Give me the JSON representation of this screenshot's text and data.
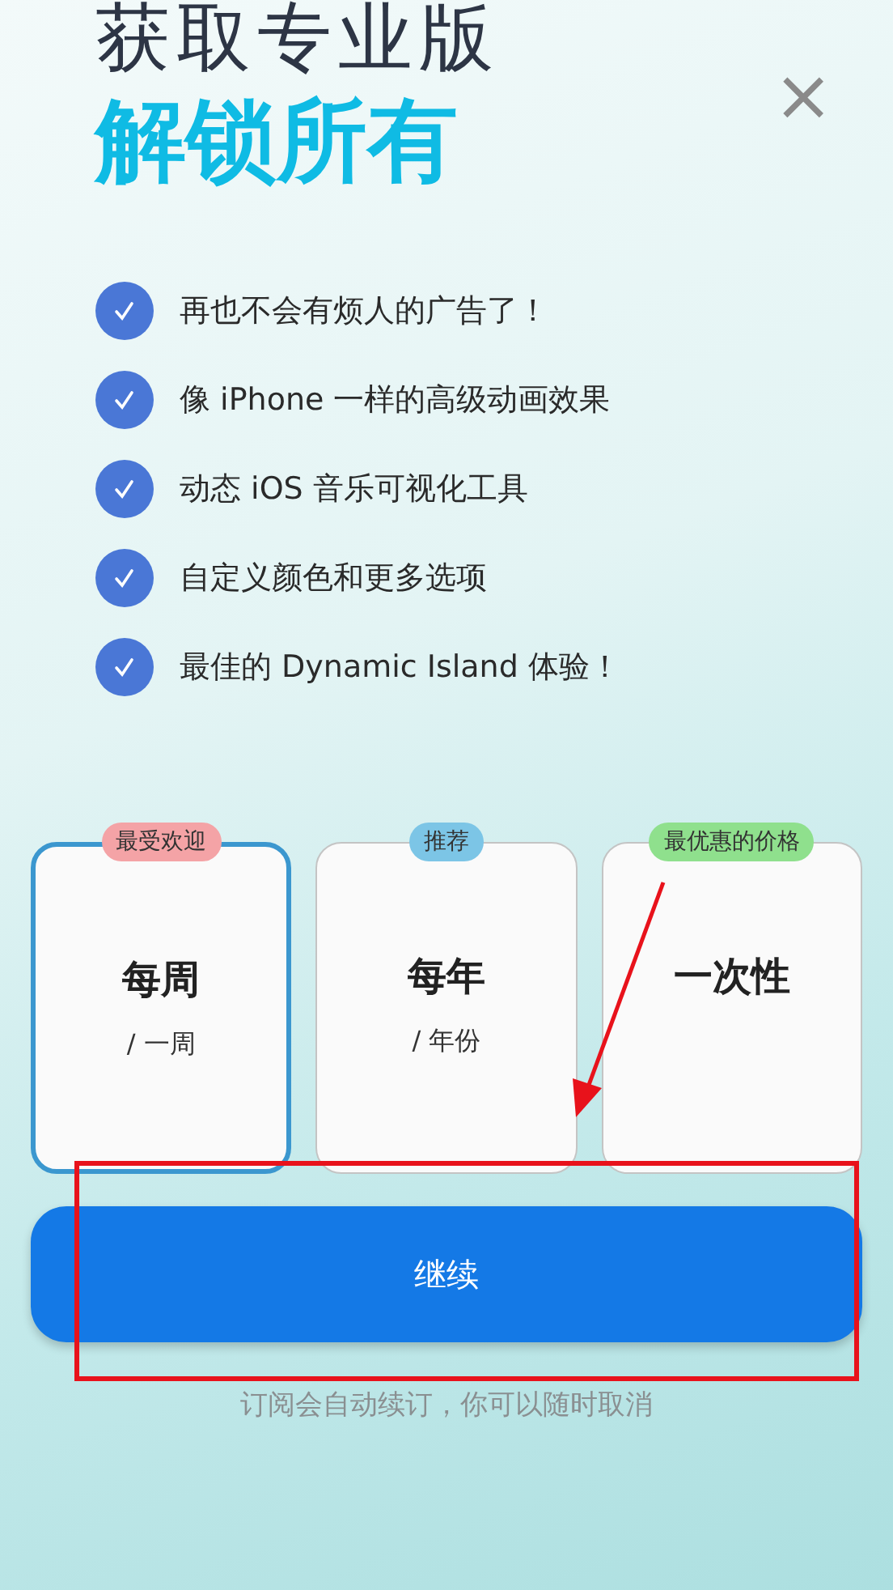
{
  "title": "获取专业版",
  "headline": "解锁所有",
  "close": "×",
  "features": [
    {
      "text": "再也不会有烦人的广告了！",
      "checked": true
    },
    {
      "text": "像 iPhone 一样的高级动画效果",
      "checked": true
    },
    {
      "text": "动态 iOS 音乐可视化工具",
      "checked": true
    },
    {
      "text": "自定义颜色和更多选项",
      "checked": true
    },
    {
      "text": "最佳的 Dynamic Island 体验！",
      "checked": true
    }
  ],
  "plans": [
    {
      "badge": "最受欢迎",
      "color": "#f4a3a6",
      "name": "每周",
      "period": "/ 一周",
      "selected": true
    },
    {
      "badge": "推荐",
      "color": "#7cc5e6",
      "name": "每年",
      "period": "/ 年份",
      "selected": false
    },
    {
      "badge": "最优惠的价格",
      "color": "#8fe08d",
      "name": "一次性",
      "selected": false
    }
  ],
  "continue_button": "继续",
  "note": "订阅会自动续订，你可以随时取消"
}
